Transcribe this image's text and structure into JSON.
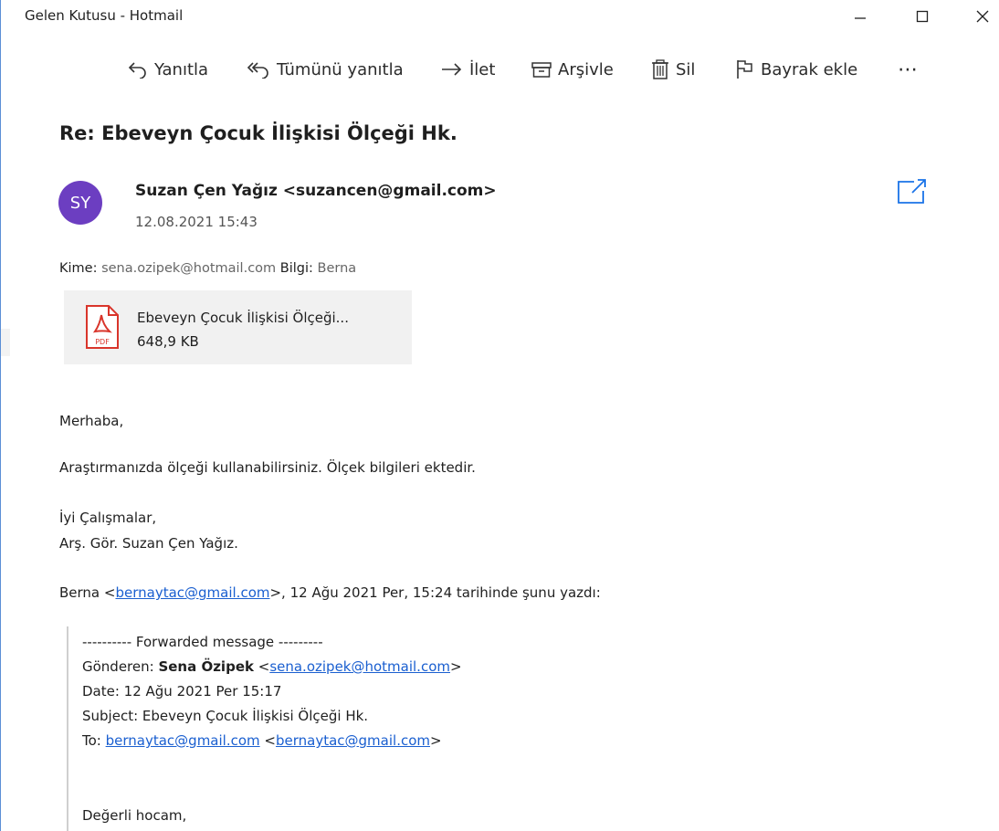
{
  "window": {
    "title": "Gelen Kutusu - Hotmail"
  },
  "toolbar": {
    "reply": "Yanıtla",
    "reply_all": "Tümünü yanıtla",
    "forward": "İlet",
    "archive": "Arşivle",
    "delete": "Sil",
    "flag": "Bayrak ekle",
    "more": "⋯"
  },
  "message": {
    "subject": "Re: Ebeveyn Çocuk İlişkisi Ölçeği Hk.",
    "avatar_initials": "SY",
    "avatar_color": "#6c3ec1",
    "sender": "Suzan Çen Yağız <suzancen@gmail.com>",
    "date": "12.08.2021 15:43",
    "to_label": "Kime:",
    "to_value": "sena.ozipek@hotmail.com",
    "cc_label": "Bilgi:",
    "cc_value": "Berna",
    "attachment": {
      "name": "Ebeveyn Çocuk İlişkisi Ölçeği...",
      "size": "648,9 KB",
      "icon_label": "PDF"
    },
    "body": {
      "greeting": "Merhaba,",
      "line1": "Araştırmanızda ölçeği kullanabilirsiniz. Ölçek bilgileri ektedir.",
      "closing1": "İyi Çalışmalar,",
      "closing2": "Arş. Gör. Suzan Çen Yağız."
    },
    "quote_header": {
      "prefix": "Berna <",
      "email": "bernaytac@gmail.com",
      "suffix": ">, 12 Ağu 2021 Per, 15:24 tarihinde şunu yazdı:"
    },
    "forwarded": {
      "divider": "---------- Forwarded message ---------",
      "from_label": "Gönderen: ",
      "from_name": "Sena Özipek",
      "from_email": "sena.ozipek@hotmail.com",
      "date_line": "Date: 12 Ağu 2021 Per 15:17",
      "subject_line": "Subject: Ebeveyn Çocuk İlişkisi Ölçeği Hk.",
      "to_label": "To: ",
      "to_email1": "bernaytac@gmail.com",
      "to_email2": "bernaytac@gmail.com",
      "salutation": "Değerli hocam,"
    }
  },
  "colors": {
    "accent": "#1a73e8",
    "link": "#1a5fd0"
  }
}
